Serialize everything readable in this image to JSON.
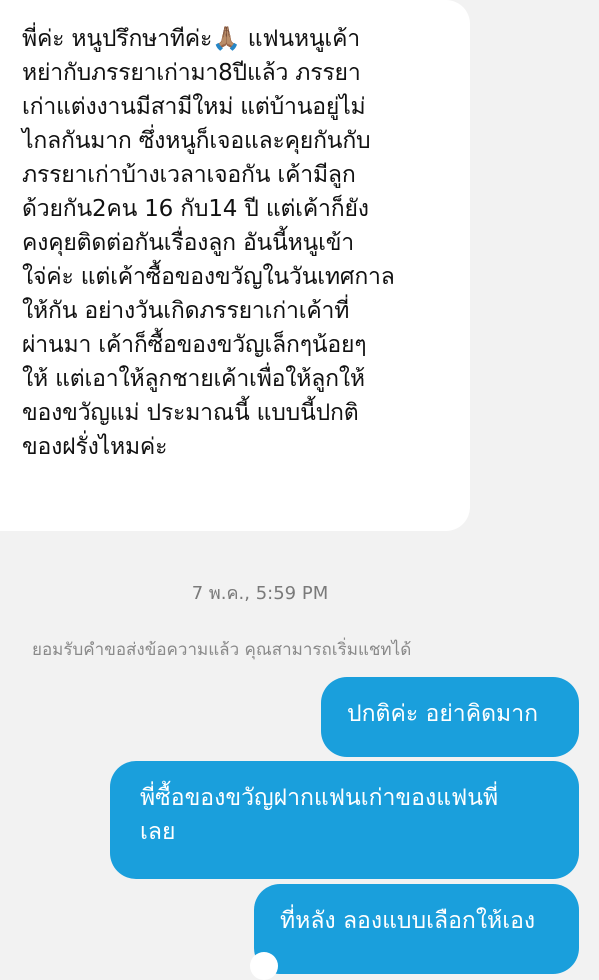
{
  "incoming_message": {
    "text": "พี่ค่ะ หนูปรึกษาทีค่ะ🙏🏽 แฟนหนูเค้า\nหย่ากับภรรยาเก่ามา8ปีแล้ว ภรรยา\nเก่าแต่งงานมีสามีใหม่ แต่บ้านอยู่ไม่\nไกลกันมาก ซึ่งหนูก็เจอและคุยกันกับ\nภรรยาเก่าบ้างเวลาเจอกัน เค้ามีลูก\nด้วยกัน2คน 16 กับ14 ปี  แต่เค้าก็ยัง\nคงคุยติดต่อกันเรื่องลูก อันนี้หนูเข้า\nใจ่ค่ะ แต่เค้าซื้อของขวัญในวันเทศกาล\nให้กัน อย่างวันเกิดภรรยาเก่าเค้าที่\nผ่านมา เค้าก็ซื้อของขวัญเล็กๆน้อยๆ\nให้ แต่เอาให้ลูกชายเค้าเพื่อให้ลูกให้\nของขวัญแม่ ประมาณนี้  แบบนี้ปกติ\nของฝรั่งไหมค่ะ"
  },
  "timestamp": "7 พ.ค., 5:59 PM",
  "system_note": "ยอมรับคำขอส่งข้อความแล้ว คุณสามารถเริ่มแชทได้",
  "outgoing_messages": [
    {
      "text": "ปกติค่ะ อย่าคิดมาก"
    },
    {
      "text": "พี่ซื้อของขวัญฝากแฟนเก่าของแฟนพี่\nเลย"
    },
    {
      "text": "ที่หลัง ลองแบบเลือกให้เอง"
    }
  ],
  "colors": {
    "outgoing_bubble": "#1a9fdc",
    "incoming_bubble": "#ffffff",
    "background": "#f2f2f2"
  }
}
